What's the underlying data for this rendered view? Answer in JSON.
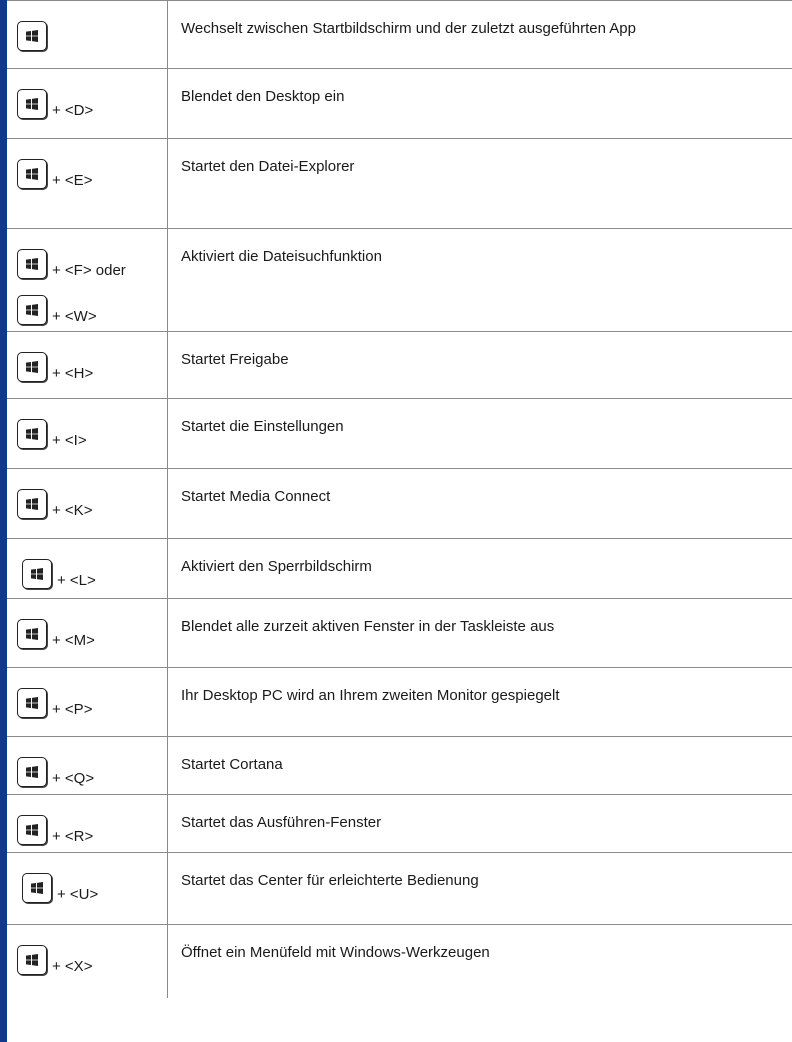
{
  "colors": {
    "accent_bar": "#0d3a8c",
    "grid": "#8a8a8a",
    "text": "#1a1a1a"
  },
  "key_icon": "windows-logo-icon",
  "rows": [
    {
      "combos": [
        ""
      ],
      "description": "Wechselt zwischen Startbildschirm und der zuletzt ausgeführten App"
    },
    {
      "combos": [
        "+ <D>"
      ],
      "description": "Blendet den Desktop ein"
    },
    {
      "combos": [
        "+ <E>"
      ],
      "description": "Startet den Datei-Explorer"
    },
    {
      "combos": [
        "+ <F> oder",
        "+ <W>"
      ],
      "description": "Aktiviert die Dateisuchfunktion"
    },
    {
      "combos": [
        "+ <H>"
      ],
      "description": "Startet Freigabe"
    },
    {
      "combos": [
        "+ <I>"
      ],
      "description": "Startet die Einstellungen"
    },
    {
      "combos": [
        "+ <K>"
      ],
      "description": "Startet Media Connect"
    },
    {
      "combos": [
        "+ <L>"
      ],
      "description": "Aktiviert den Sperrbildschirm"
    },
    {
      "combos": [
        "+ <M>"
      ],
      "description": "Blendet alle zurzeit aktiven Fenster in der Taskleiste aus"
    },
    {
      "combos": [
        "+ <P>"
      ],
      "description": "Ihr Desktop PC wird an Ihrem zweiten Monitor gespiegelt"
    },
    {
      "combos": [
        "+ <Q>"
      ],
      "description": "Startet Cortana"
    },
    {
      "combos": [
        "+ <R>"
      ],
      "description": "Startet das Ausführen-Fenster"
    },
    {
      "combos": [
        "+ <U>"
      ],
      "description": "Startet das Center für erleichterte Bedienung"
    },
    {
      "combos": [
        "+ <X>"
      ],
      "description": "Öffnet ein Menüfeld mit Windows-Werkzeugen"
    }
  ]
}
